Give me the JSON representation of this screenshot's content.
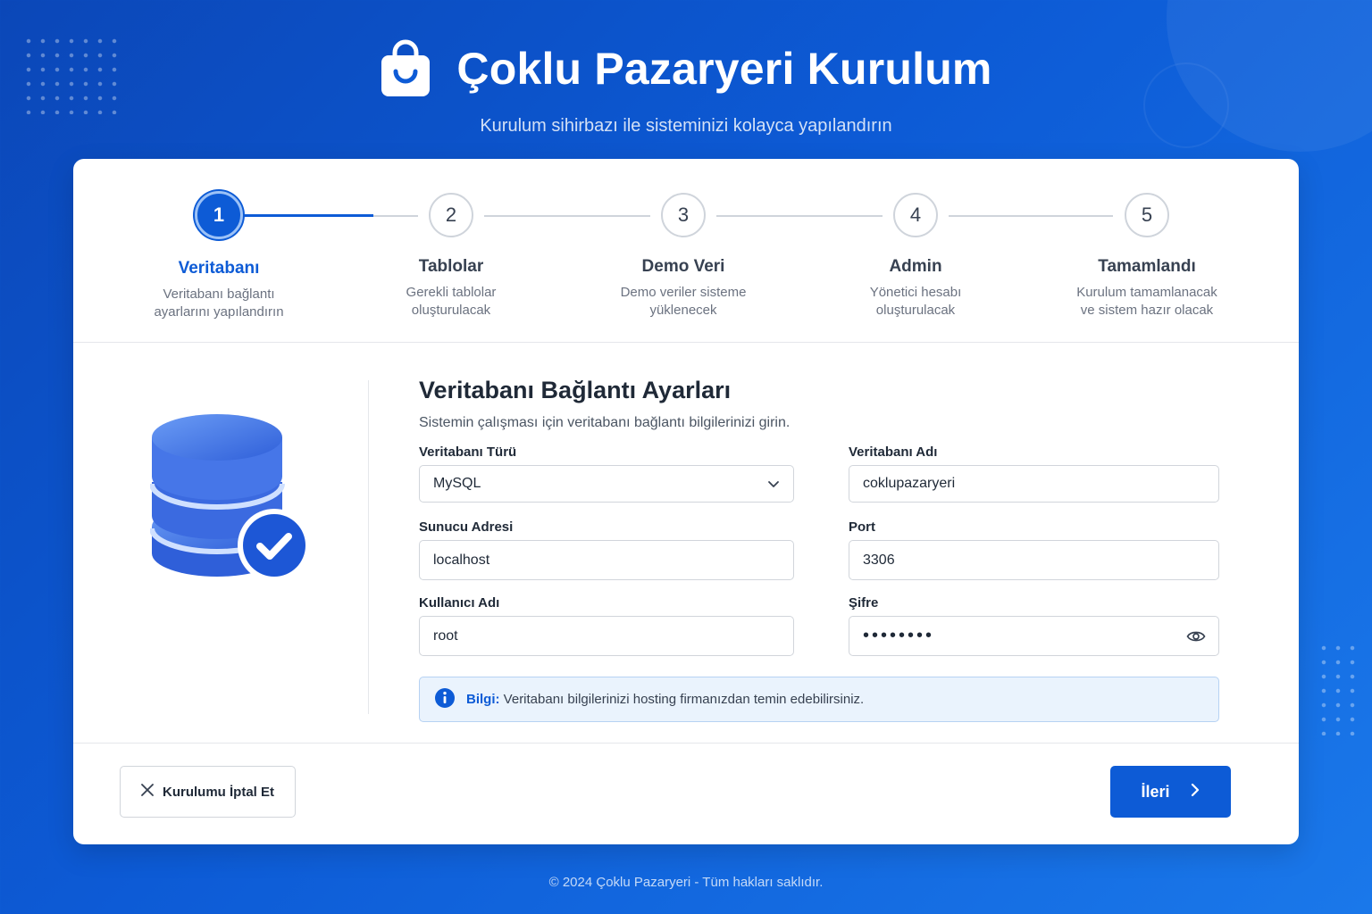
{
  "header": {
    "title": "Çoklu Pazaryeri Kurulum",
    "subtitle": "Kurulum sihirbazı ile sisteminizi kolayca yapılandırın"
  },
  "steps": [
    {
      "number": "1",
      "title": "Veritabanı",
      "desc_line1": "Veritabanı bağlantı",
      "desc_line2": "ayarlarını yapılandırın",
      "active": true
    },
    {
      "number": "2",
      "title": "Tablolar",
      "desc_line1": "Gerekli tablolar",
      "desc_line2": "oluşturulacak",
      "active": false
    },
    {
      "number": "3",
      "title": "Demo Veri",
      "desc_line1": "Demo veriler sisteme",
      "desc_line2": "yüklenecek",
      "active": false
    },
    {
      "number": "4",
      "title": "Admin",
      "desc_line1": "Yönetici hesabı",
      "desc_line2": "oluşturulacak",
      "active": false
    },
    {
      "number": "5",
      "title": "Tamamlandı",
      "desc_line1": "Kurulum tamamlanacak",
      "desc_line2": "ve sistem hazır olacak",
      "active": false
    }
  ],
  "form": {
    "title": "Veritabanı Bağlantı Ayarları",
    "description": "Sistemin çalışması için veritabanı bağlantı bilgilerinizi girin.",
    "db_type": {
      "label": "Veritabanı Türü",
      "value": "MySQL"
    },
    "db_name": {
      "label": "Veritabanı Adı",
      "value": "coklupazaryeri"
    },
    "host": {
      "label": "Sunucu Adresi",
      "value": "localhost"
    },
    "port": {
      "label": "Port",
      "value": "3306"
    },
    "username": {
      "label": "Kullanıcı Adı",
      "value": "root"
    },
    "password": {
      "label": "Şifre",
      "value": "••••••••"
    }
  },
  "info": {
    "label": "Bilgi:",
    "text": "Veritabanı bilgilerinizi hosting firmanızdan temin edebilirsiniz."
  },
  "buttons": {
    "cancel": "Kurulumu İptal Et",
    "next": "İleri"
  },
  "footer": {
    "copyright": "© 2024 Çoklu Pazaryeri - Tüm hakları saklıdır."
  },
  "colors": {
    "primary": "#0d5bd6",
    "background_start": "#0b47b8",
    "background_end": "#1a78ea",
    "info_bg": "#eaf3fd"
  },
  "icons": {
    "logo": "shopping-bag-icon",
    "illustration": "database-check-icon",
    "select": "chevron-down-icon",
    "password_toggle": "eye-icon",
    "info": "info-icon",
    "cancel": "close-icon",
    "next": "chevron-right-icon"
  }
}
